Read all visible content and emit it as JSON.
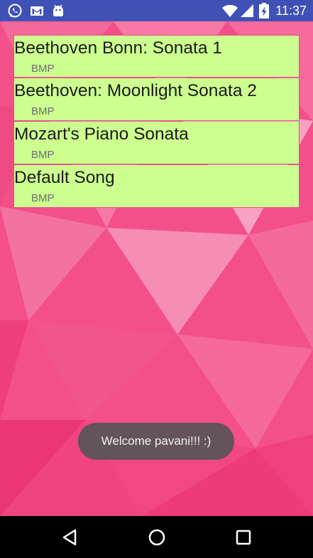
{
  "status_bar": {
    "time": "11:37",
    "icons": [
      "whatsapp-icon",
      "gmail-icon",
      "android-icon",
      "wifi-icon",
      "signal-icon",
      "battery-charging-icon"
    ],
    "background_color": "#3f51b5"
  },
  "songs": [
    {
      "title": "Beethoven Bonn: Sonata 1",
      "subtitle": "BMP"
    },
    {
      "title": "Beethoven: Moonlight Sonata 2",
      "subtitle": "BMP"
    },
    {
      "title": "Mozart's Piano Sonata",
      "subtitle": "BMP"
    },
    {
      "title": "Default Song",
      "subtitle": "BMP"
    }
  ],
  "list_item_color": "#ccff90",
  "toast": {
    "text": "Welcome pavani!!! :)"
  },
  "nav_bar": {
    "buttons": [
      "back-icon",
      "home-icon",
      "recents-icon"
    ]
  }
}
